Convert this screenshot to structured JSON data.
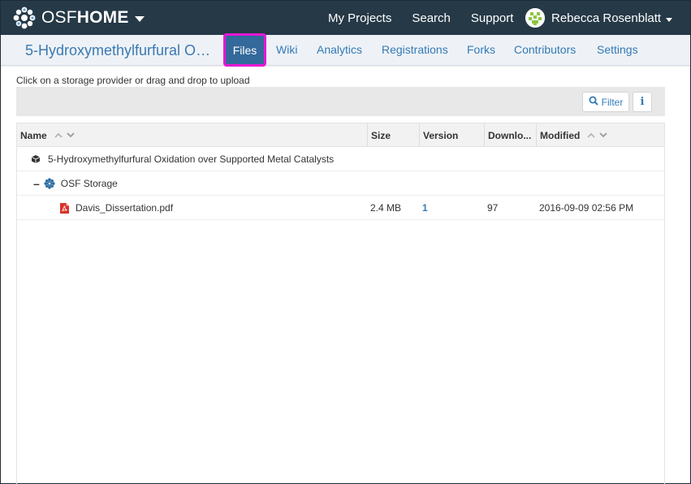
{
  "navbar": {
    "brand_osf": "OSF",
    "brand_home": "HOME",
    "links": [
      "My Projects",
      "Search",
      "Support"
    ],
    "user_name": "Rebecca Rosenblatt",
    "bg_color": "#263947"
  },
  "project_nav": {
    "title": "5-Hydroxymethylfurfural Oxi...",
    "tabs": [
      "Files",
      "Wiki",
      "Analytics",
      "Registrations",
      "Forks",
      "Contributors",
      "Settings"
    ],
    "active_tab": "Files",
    "highlight_color": "#e617d4"
  },
  "files": {
    "upload_hint": "Click on a storage provider or drag and drop to upload",
    "filter_label": "Filter",
    "info_label": "i",
    "columns": [
      "Name",
      "Size",
      "Version",
      "Downlo...",
      "Modified"
    ],
    "project_name": "5-Hydroxymethylfurfural Oxidation over Supported Metal Catalysts",
    "storage": {
      "toggle": "–",
      "name": "OSF Storage"
    },
    "rows": [
      {
        "name": "Davis_Dissertation.pdf",
        "size": "2.4 MB",
        "version": "1",
        "downloads": "97",
        "modified": "2016-09-09 02:56 PM",
        "icon": "pdf-icon"
      }
    ]
  }
}
